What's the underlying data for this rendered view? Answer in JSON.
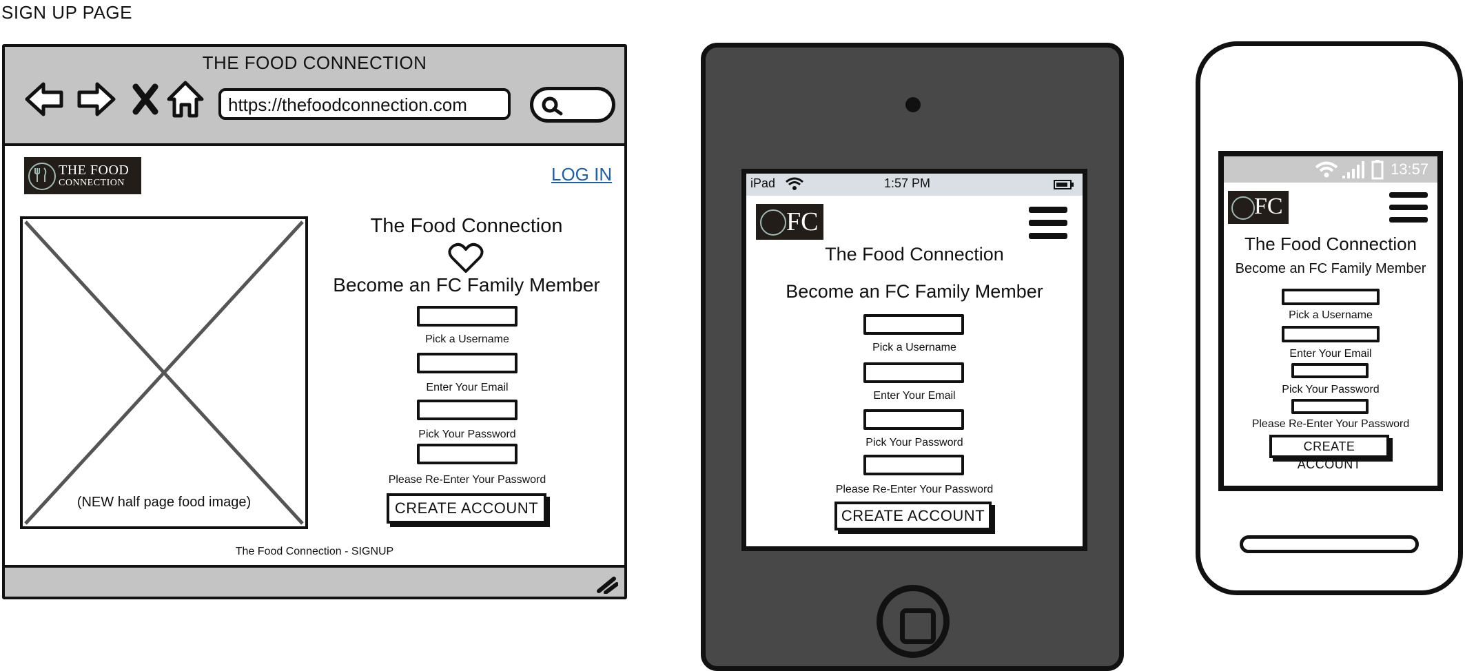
{
  "page_label": "SIGN UP PAGE",
  "desktop": {
    "window_title": "THE FOOD CONNECTION",
    "nav_icons": [
      "back-arrow-icon",
      "forward-arrow-icon",
      "close-x-icon",
      "home-icon"
    ],
    "url": "https://thefoodconnection.com",
    "logo": {
      "line1": "THE FOOD",
      "line2": "CONNECTION"
    },
    "login_link": "LOG IN",
    "image_caption": "(NEW half page food image)",
    "title": "The Food Connection",
    "subtitle": "Become an FC Family Member",
    "fields": [
      {
        "label": "Pick a Username"
      },
      {
        "label": "Enter Your Email"
      },
      {
        "label": "Pick Your Password"
      },
      {
        "label": "Please Re-Enter Your Password"
      }
    ],
    "button": "CREATE ACCOUNT",
    "footer": "The Food Connection  - SIGNUP"
  },
  "tablet": {
    "status": {
      "device": "iPad",
      "time": "1:57 PM"
    },
    "logo_text": "FC",
    "title": "The Food Connection",
    "subtitle": "Become an FC Family Member",
    "fields": [
      {
        "label": "Pick a Username"
      },
      {
        "label": "Enter Your Email"
      },
      {
        "label": "Pick Your Password"
      },
      {
        "label": "Please Re-Enter Your Password"
      }
    ],
    "button": "CREATE ACCOUNT"
  },
  "phone": {
    "status": {
      "time": "13:57"
    },
    "logo_text": "FC",
    "title": "The Food Connection",
    "subtitle": "Become an FC Family Member",
    "fields": [
      {
        "label": "Pick a Username"
      },
      {
        "label": "Enter Your Email"
      },
      {
        "label": "Pick Your Password"
      },
      {
        "label": "Please Re-Enter Your Password"
      }
    ],
    "button": "CREATE ACCOUNT"
  }
}
